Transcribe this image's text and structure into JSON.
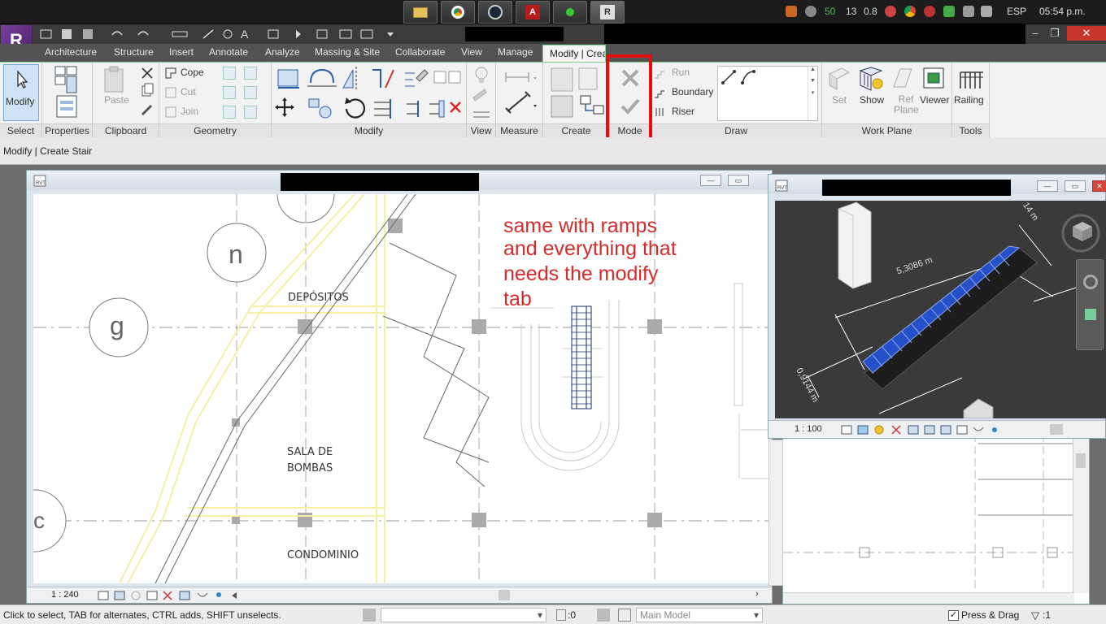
{
  "taskbar": {
    "tray": {
      "num1": "50",
      "num2": "13",
      "num3": "0.8",
      "language": "ESP",
      "clock": "05:54 p.m."
    }
  },
  "tabs": [
    "Architecture",
    "Structure",
    "Insert",
    "Annotate",
    "Analyze",
    "Massing & Site",
    "Collaborate",
    "View",
    "Manage",
    "Modify | Crea"
  ],
  "ribbon": {
    "select_panel": {
      "title": "Select",
      "modify": "Modify"
    },
    "properties_panel": {
      "title": "Properties"
    },
    "clipboard_panel": {
      "title": "Clipboard",
      "paste": "Paste"
    },
    "geometry_panel": {
      "title": "Geometry",
      "cope": "Cope",
      "cut": "Cut",
      "join": "Join"
    },
    "modify_panel": {
      "title": "Modify"
    },
    "view_panel": {
      "title": "View"
    },
    "measure_panel": {
      "title": "Measure"
    },
    "create_panel": {
      "title": "Create"
    },
    "mode_panel": {
      "title": "Mode"
    },
    "draw_panel": {
      "title": "Draw",
      "run": "Run",
      "boundary": "Boundary",
      "riser": "Riser"
    },
    "workplane_panel": {
      "title": "Work Plane",
      "set": "Set",
      "show": "Show",
      "ref_plane": "Ref Plane",
      "viewer": "Viewer"
    },
    "tools_panel": {
      "title": "Tools",
      "railing": "Railing"
    }
  },
  "options_bar": {
    "context": "Modify | Create Stair"
  },
  "plan_view": {
    "labels": {
      "grid_n": "n",
      "grid_g": "g",
      "grid_c": "c",
      "room1": "DEPÓSITOS",
      "room2_l1": "SALA DE",
      "room2_l2": "BOMBAS",
      "room3": "CONDOMINIO"
    },
    "annotation": [
      "same with ramps",
      "and everything that",
      "needs the modify",
      "tab"
    ],
    "scale": "1 : 240"
  },
  "view3d": {
    "dim1": "5,3086 m",
    "dim2": "0,9144 m",
    "dim3": "14 m",
    "scale": "1 : 100"
  },
  "statusbar": {
    "hint": "Click to select, TAB for alternates, CTRL adds, SHIFT unselects.",
    "zero": ":0",
    "model": "Main Model",
    "press_drag": "Press & Drag",
    "filter": ":1"
  },
  "colors": {
    "accent": "#7fd28f",
    "annotation": "#d62b2b",
    "highlight_box": "#e01010",
    "stair_blue": "#2451c9"
  }
}
